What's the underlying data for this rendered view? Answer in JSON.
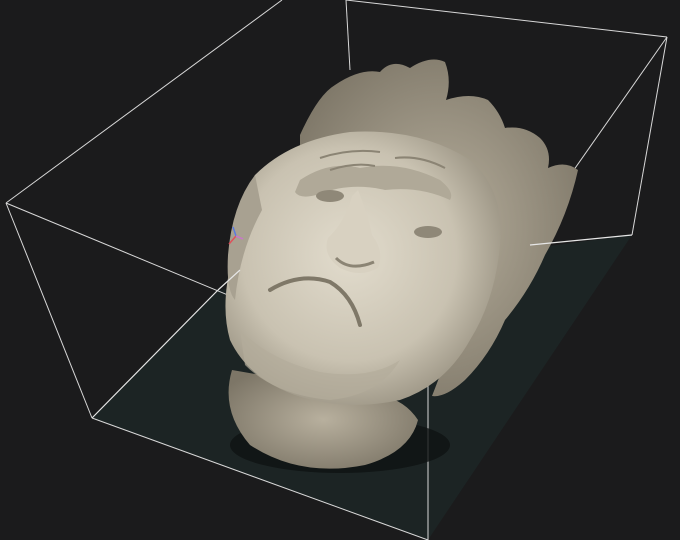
{
  "viewer": {
    "background_color": "#1b1b1c",
    "floor_color": "#1c2424",
    "bounding_box_color": "#e6e6e6",
    "model_color": "#c9c2b1",
    "axis_colors": {
      "x": "#e0505a",
      "y": "#5a7ae0",
      "z": "#c878c8"
    },
    "icons": [
      "gizmo-axes-icon"
    ]
  }
}
